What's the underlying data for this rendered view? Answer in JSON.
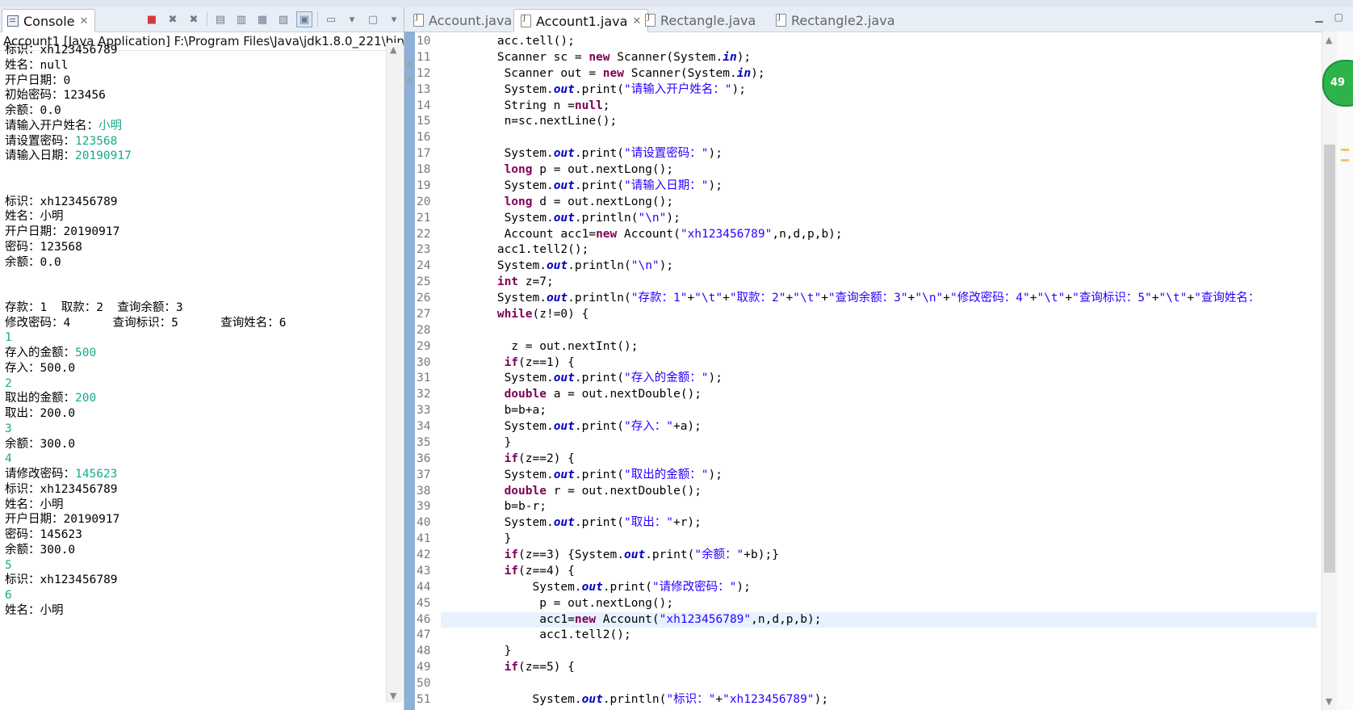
{
  "console": {
    "tab_label": "Console",
    "header": "Account1 [Java Application] F:\\Program Files\\Java\\jdk1.8.0_221\\bin\\",
    "lines": [
      {
        "text": "标识：xh123456789"
      },
      {
        "text": "姓名：null"
      },
      {
        "text": "开户日期：0"
      },
      {
        "text": "初始密码：123456"
      },
      {
        "text": "余额：0.0"
      },
      {
        "text": "请输入开户姓名：",
        "input": "小明"
      },
      {
        "text": "请设置密码：",
        "input": "123568"
      },
      {
        "text": "请输入日期：",
        "input": "20190917"
      },
      {
        "text": ""
      },
      {
        "text": ""
      },
      {
        "text": "标识：xh123456789"
      },
      {
        "text": "姓名：小明"
      },
      {
        "text": "开户日期：20190917"
      },
      {
        "text": "密码：123568"
      },
      {
        "text": "余额：0.0"
      },
      {
        "text": ""
      },
      {
        "text": ""
      },
      {
        "text": "存款：1  取款：2  查询余额：3"
      },
      {
        "text": "修改密码：4      查询标识：5      查询姓名：6"
      },
      {
        "text": "",
        "input": "1"
      },
      {
        "text": "存入的金额：",
        "input": "500"
      },
      {
        "text": "存入：500.0"
      },
      {
        "text": "",
        "input": "2"
      },
      {
        "text": "取出的金额：",
        "input": "200"
      },
      {
        "text": "取出：200.0"
      },
      {
        "text": "",
        "input": "3"
      },
      {
        "text": "余额：300.0"
      },
      {
        "text": "",
        "input": "4"
      },
      {
        "text": "请修改密码：",
        "input": "145623"
      },
      {
        "text": "标识：xh123456789"
      },
      {
        "text": "姓名：小明"
      },
      {
        "text": "开户日期：20190917"
      },
      {
        "text": "密码：145623"
      },
      {
        "text": "余额：300.0"
      },
      {
        "text": "",
        "input": "5"
      },
      {
        "text": "标识：xh123456789"
      },
      {
        "text": "",
        "input": "6"
      },
      {
        "text": "姓名：小明"
      }
    ]
  },
  "editor": {
    "tabs": [
      {
        "label": "Account.java",
        "active": false
      },
      {
        "label": "Account1.java",
        "active": true
      },
      {
        "label": "Rectangle.java",
        "active": false
      },
      {
        "label": "Rectangle2.java",
        "active": false
      }
    ],
    "badge": "49",
    "highlight_line": 46,
    "lines": [
      {
        "n": 10,
        "t": "        acc.tell();"
      },
      {
        "n": 11,
        "t": "        Scanner sc = new Scanner(System.in);"
      },
      {
        "n": 12,
        "t": "         Scanner out = new Scanner(System.in);"
      },
      {
        "n": 13,
        "t": "         System.out.print(\"请输入开户姓名：\");"
      },
      {
        "n": 14,
        "t": "         String n =null;"
      },
      {
        "n": 15,
        "t": "         n=sc.nextLine();"
      },
      {
        "n": 16,
        "t": ""
      },
      {
        "n": 17,
        "t": "         System.out.print(\"请设置密码：\");"
      },
      {
        "n": 18,
        "t": "         long p = out.nextLong();"
      },
      {
        "n": 19,
        "t": "         System.out.print(\"请输入日期：\");"
      },
      {
        "n": 20,
        "t": "         long d = out.nextLong();"
      },
      {
        "n": 21,
        "t": "         System.out.println(\"\\n\");"
      },
      {
        "n": 22,
        "t": "         Account acc1=new Account(\"xh123456789\",n,d,p,b);"
      },
      {
        "n": 23,
        "t": "        acc1.tell2();"
      },
      {
        "n": 24,
        "t": "        System.out.println(\"\\n\");"
      },
      {
        "n": 25,
        "t": "        int z=7;"
      },
      {
        "n": 26,
        "t": "        System.out.println(\"存款：1\"+\"\\t\"+\"取款：2\"+\"\\t\"+\"查询余额：3\"+\"\\n\"+\"修改密码：4\"+\"\\t\"+\"查询标识：5\"+\"\\t\"+\"查询姓名："
      },
      {
        "n": 27,
        "t": "        while(z!=0) {"
      },
      {
        "n": 28,
        "t": ""
      },
      {
        "n": 29,
        "t": "          z = out.nextInt();"
      },
      {
        "n": 30,
        "t": "         if(z==1) {"
      },
      {
        "n": 31,
        "t": "         System.out.print(\"存入的金额：\");"
      },
      {
        "n": 32,
        "t": "         double a = out.nextDouble();"
      },
      {
        "n": 33,
        "t": "         b=b+a;"
      },
      {
        "n": 34,
        "t": "         System.out.print(\"存入：\"+a);"
      },
      {
        "n": 35,
        "t": "         }"
      },
      {
        "n": 36,
        "t": "         if(z==2) {"
      },
      {
        "n": 37,
        "t": "         System.out.print(\"取出的金额：\");"
      },
      {
        "n": 38,
        "t": "         double r = out.nextDouble();"
      },
      {
        "n": 39,
        "t": "         b=b-r;"
      },
      {
        "n": 40,
        "t": "         System.out.print(\"取出：\"+r);"
      },
      {
        "n": 41,
        "t": "         }"
      },
      {
        "n": 42,
        "t": "         if(z==3) {System.out.print(\"余额：\"+b);}"
      },
      {
        "n": 43,
        "t": "         if(z==4) {"
      },
      {
        "n": 44,
        "t": "             System.out.print(\"请修改密码：\");"
      },
      {
        "n": 45,
        "t": "              p = out.nextLong();"
      },
      {
        "n": 46,
        "t": "              acc1=new Account(\"xh123456789\",n,d,p,b);"
      },
      {
        "n": 47,
        "t": "              acc1.tell2();"
      },
      {
        "n": 48,
        "t": "         }"
      },
      {
        "n": 49,
        "t": "         if(z==5) {"
      },
      {
        "n": 50,
        "t": ""
      },
      {
        "n": 51,
        "t": "             System.out.println(\"标识：\"+\"xh123456789\");"
      }
    ]
  },
  "icons": [
    "console-icon",
    "terminate-icon",
    "remove-launch-icon",
    "remove-all-icon",
    "clear-console-icon",
    "scroll-lock-icon",
    "word-wrap-icon",
    "pin-console-icon",
    "display-console-icon",
    "open-console-icon",
    "java-file-icon"
  ],
  "colors": {
    "keyword": "#7f0055",
    "string": "#2a00ff",
    "static_field": "#0000c0",
    "console_input": "#1aa98a",
    "current_line": "#e8f2fe"
  }
}
